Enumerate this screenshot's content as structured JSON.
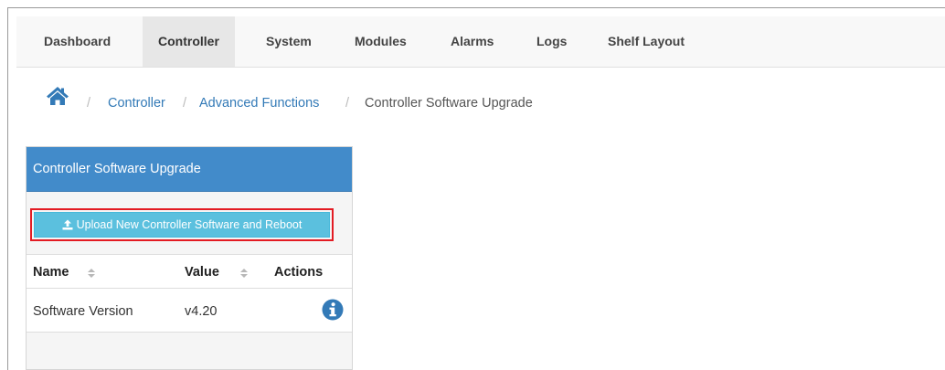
{
  "nav": {
    "items": [
      {
        "label": "Dashboard",
        "active": false
      },
      {
        "label": "Controller",
        "active": true
      },
      {
        "label": "System",
        "active": false
      },
      {
        "label": "Modules",
        "active": false
      },
      {
        "label": "Alarms",
        "active": false
      },
      {
        "label": "Logs",
        "active": false
      },
      {
        "label": "Shelf Layout",
        "active": false
      }
    ]
  },
  "breadcrumb": {
    "home_icon": "home-icon",
    "separator": "/",
    "items": [
      {
        "label": "Controller",
        "link": true
      },
      {
        "label": "Advanced Functions",
        "link": true
      },
      {
        "label": "Controller Software Upgrade",
        "link": false
      }
    ]
  },
  "panel": {
    "title": "Controller Software Upgrade",
    "upload_button": {
      "label": "Upload New Controller Software and Reboot",
      "icon": "upload-icon"
    },
    "table": {
      "columns": [
        "Name",
        "Value",
        "Actions"
      ],
      "rows": [
        {
          "name": "Software Version",
          "value": "v4.20",
          "action_icon": "info-icon"
        }
      ]
    }
  },
  "colors": {
    "panel_header": "#428bca",
    "button": "#5bc0de",
    "link": "#337ab7",
    "highlight": "#e31b23"
  }
}
